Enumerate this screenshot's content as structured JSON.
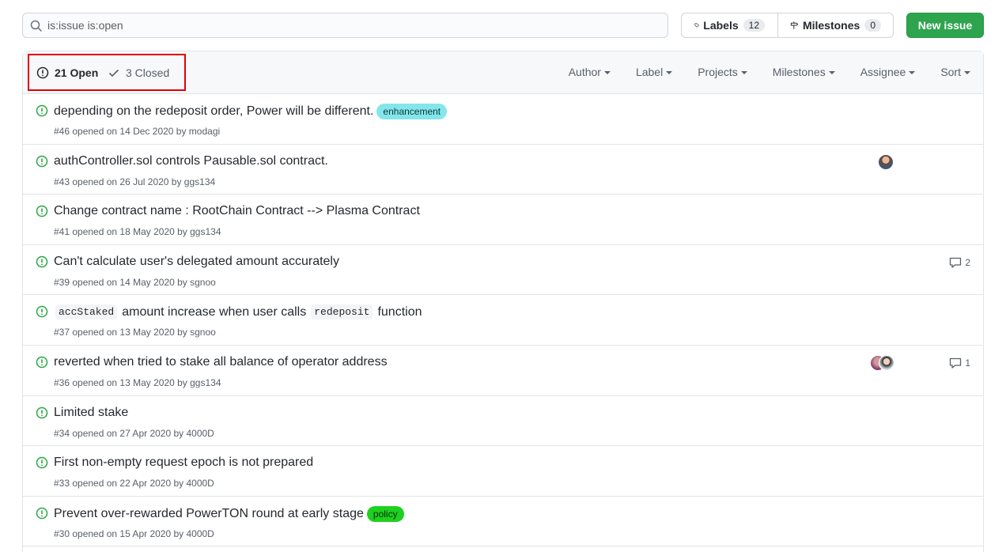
{
  "search": {
    "value": "is:issue is:open"
  },
  "labels_button": {
    "label": "Labels",
    "count": "12"
  },
  "milestones_button": {
    "label": "Milestones",
    "count": "0"
  },
  "new_issue": {
    "label": "New issue"
  },
  "states": {
    "open": "21 Open",
    "closed": "3 Closed"
  },
  "filters": [
    "Author",
    "Label",
    "Projects",
    "Milestones",
    "Assignee",
    "Sort"
  ],
  "issues": [
    {
      "title": "depending on the redeposit order, Power will be different.",
      "label": "enhancement",
      "meta": "#46 opened on 14 Dec 2020 by modagi"
    },
    {
      "title": "authController.sol controls Pausable.sol contract.",
      "meta": "#43 opened on 26 Jul 2020 by ggs134"
    },
    {
      "title": "Change contract name : RootChain Contract --> Plasma Contract",
      "meta": "#41 opened on 18 May 2020 by ggs134"
    },
    {
      "title": "Can't calculate user's delegated amount accurately",
      "meta": "#39 opened on 14 May 2020 by sgnoo",
      "comments": "2"
    },
    {
      "code1": "accStaked",
      "title_mid": "amount increase when user calls",
      "code2": "redeposit",
      "title_end": "function",
      "meta": "#37 opened on 13 May 2020 by sgnoo"
    },
    {
      "title": "reverted when tried to stake all balance of operator address",
      "meta": "#36 opened on 13 May 2020 by ggs134",
      "comments": "1"
    },
    {
      "title": "Limited stake",
      "meta": "#34 opened on 27 Apr 2020 by 4000D"
    },
    {
      "title": "First non-empty request epoch is not prepared",
      "meta": "#33 opened on 22 Apr 2020 by 4000D"
    },
    {
      "title": "Prevent over-rewarded PowerTON round at early stage",
      "label": "policy",
      "meta": "#30 opened on 15 Apr 2020 by 4000D"
    }
  ],
  "colors": {
    "open_icon": "#28a745",
    "enhancement_bg": "#84e6eb",
    "policy_bg": "#1ed11e",
    "highlight": "#e0000b",
    "primary": "#2ea44f"
  }
}
